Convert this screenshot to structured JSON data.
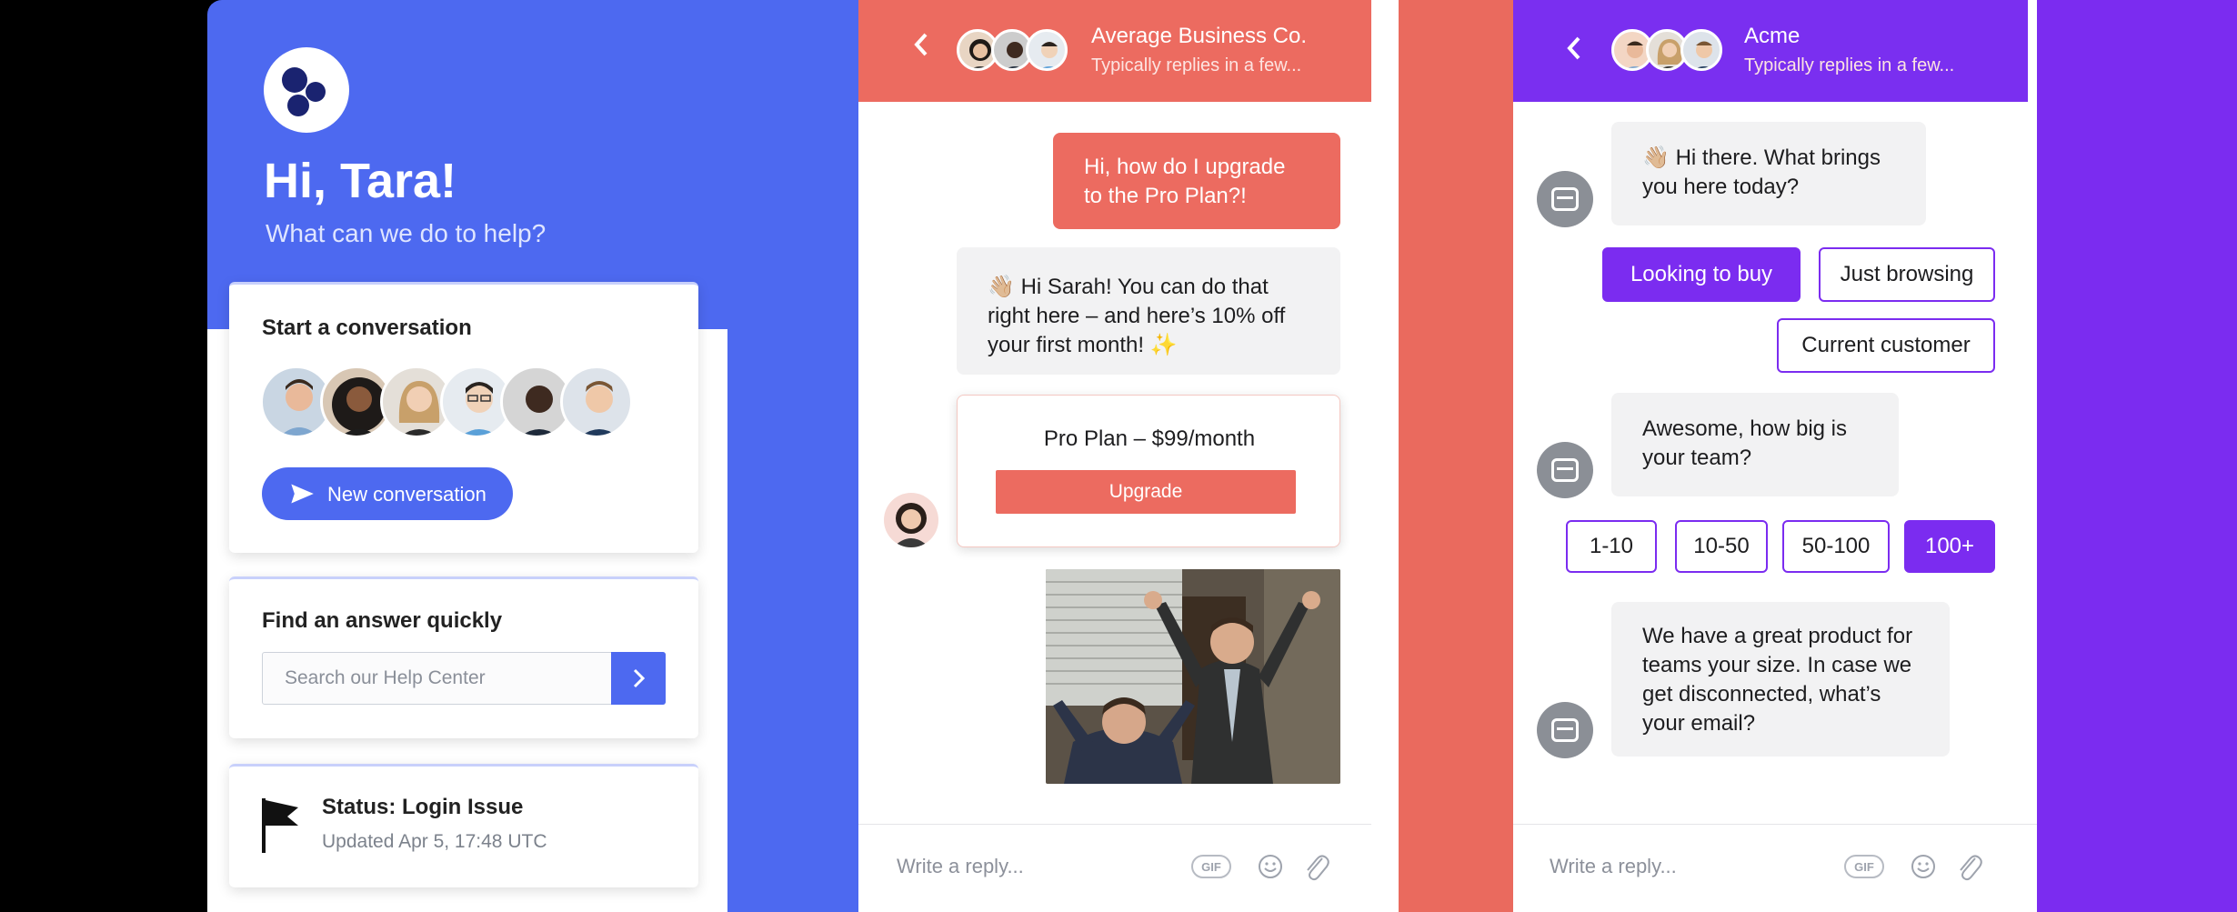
{
  "messenger": {
    "greeting": "Hi, Tara!",
    "subtitle": "What can we do to help?",
    "start_conversation": {
      "title": "Start a conversation",
      "button_label": "New conversation"
    },
    "find_answer": {
      "title": "Find an answer quickly",
      "search_placeholder": "Search our Help Center"
    },
    "status": {
      "title": "Status: Login Issue",
      "updated": "Updated Apr 5, 17:48 UTC"
    },
    "colors": {
      "brand": "#4d69f0"
    }
  },
  "chat_business": {
    "header": {
      "company": "Average Business Co.",
      "reply_time": "Typically replies in a few..."
    },
    "messages": {
      "user_1": "Hi, how do I upgrade to the Pro Plan?!",
      "bot_1_emoji": "👋🏼",
      "bot_1": "Hi Sarah! You can do that right here – and here’s 10% off your first month!",
      "bot_1_sparkle": "✨"
    },
    "plan_card": {
      "title": "Pro Plan – $99/month",
      "button_label": "Upgrade"
    },
    "composer": {
      "placeholder": "Write a reply...",
      "gif_label": "GIF"
    },
    "colors": {
      "brand": "#ec6b60"
    }
  },
  "chat_acme": {
    "header": {
      "company": "Acme",
      "reply_time": "Typically replies in a few..."
    },
    "messages": {
      "bot_1_emoji": "👋🏼",
      "bot_1": "Hi there. What brings you here today?",
      "bot_2": "Awesome, how big is your team?",
      "bot_3": "We have a great product for teams your size. In case we get disconnected, what’s your email?"
    },
    "reply_options_1": [
      "Looking to buy",
      "Just browsing",
      "Current customer"
    ],
    "reply_options_2": [
      "1-10",
      "10-50",
      "50-100",
      "100+"
    ],
    "composer": {
      "placeholder": "Write a reply...",
      "gif_label": "GIF"
    },
    "colors": {
      "brand": "#7b2cf0"
    }
  }
}
